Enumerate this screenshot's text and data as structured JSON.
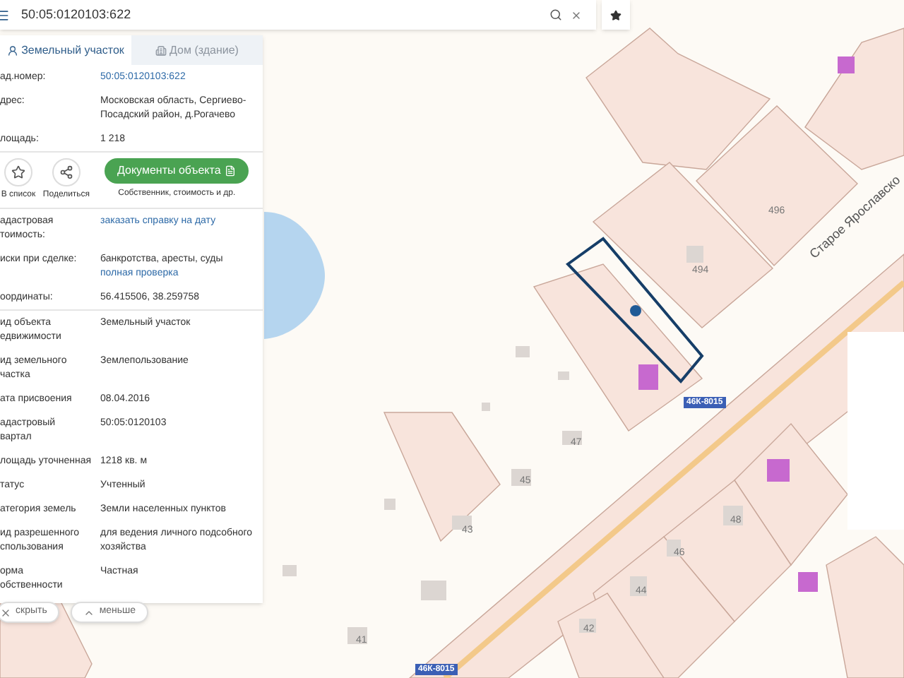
{
  "search": {
    "value": "50:05:0120103:622"
  },
  "tabs": [
    {
      "label": "Земельный участок",
      "selected": true,
      "disabled": false
    },
    {
      "label": "Дом (здание)",
      "selected": false,
      "disabled": true
    }
  ],
  "sections": [
    {
      "kind": "rows",
      "rows": [
        {
          "label": [
            "ад.номер:"
          ],
          "value": [
            {
              "kind": "link",
              "text": "50:05:0120103:622"
            }
          ]
        },
        {
          "label": [
            "дрес:"
          ],
          "value": [
            {
              "kind": "text",
              "text": "Московская область, Сергиево-Посадский район, д.Рогачево"
            }
          ]
        },
        {
          "label": [
            "лощадь:"
          ],
          "value": [
            {
              "kind": "text",
              "text": "1 218"
            }
          ]
        }
      ]
    },
    {
      "kind": "actions",
      "actions": [
        {
          "kind": "star",
          "label": "В список"
        },
        {
          "kind": "share",
          "label": "Поделиться"
        }
      ],
      "button": "Документы объекта",
      "caption": "Собственник, стоимость и др."
    },
    {
      "kind": "rows",
      "rows": [
        {
          "label": [
            "адастровая",
            "тоимость:"
          ],
          "value": [
            {
              "kind": "link",
              "text": "заказать справку на дату"
            }
          ]
        },
        {
          "label": [
            "иски при сделке:"
          ],
          "value": [
            {
              "kind": "text",
              "text": "банкротства, аресты, суды"
            },
            {
              "kind": "link",
              "text": "полная проверка"
            }
          ]
        },
        {
          "label": [
            "оординаты:"
          ],
          "value": [
            {
              "kind": "text",
              "text": "56.415506, 38.259758"
            }
          ]
        }
      ]
    },
    {
      "kind": "rows",
      "rows": [
        {
          "label": [
            "ид объекта",
            "едвижимости"
          ],
          "value": [
            {
              "kind": "text",
              "text": "Земельный участок"
            }
          ]
        },
        {
          "label": [
            "ид земельного",
            "частка"
          ],
          "value": [
            {
              "kind": "text",
              "text": "Землепользование"
            }
          ]
        },
        {
          "label": [
            "ата присвоения"
          ],
          "value": [
            {
              "kind": "text",
              "text": "08.04.2016"
            }
          ]
        },
        {
          "label": [
            "адастровый",
            "вартал"
          ],
          "value": [
            {
              "kind": "text",
              "text": "50:05:0120103"
            }
          ]
        },
        {
          "label": [
            "лощадь уточненная"
          ],
          "value": [
            {
              "kind": "text",
              "text": "1218 кв. м"
            }
          ]
        },
        {
          "label": [
            "татус"
          ],
          "value": [
            {
              "kind": "text",
              "text": "Учтенный"
            }
          ]
        },
        {
          "label": [
            "атегория земель"
          ],
          "value": [
            {
              "kind": "text",
              "text": "Земли населенных пунктов"
            }
          ]
        },
        {
          "label": [
            "ид разрешенного",
            "спользования"
          ],
          "value": [
            {
              "kind": "text",
              "text": "для ведения личного подсобного хозяйства"
            }
          ]
        },
        {
          "label": [
            "орма",
            "обственности"
          ],
          "value": [
            {
              "kind": "text",
              "text": "Частная"
            }
          ]
        }
      ]
    }
  ],
  "footer_buttons": [
    {
      "kind": "close",
      "label": "скрыть"
    },
    {
      "kind": "up",
      "label": "меньше"
    }
  ],
  "map": {
    "road_name": "Старое Ярославско",
    "route_badges": [
      "46К-8015",
      "46К-8015"
    ],
    "house_numbers": [
      "496",
      "494",
      "47",
      "45",
      "43",
      "48",
      "46",
      "44",
      "42",
      "41"
    ]
  }
}
